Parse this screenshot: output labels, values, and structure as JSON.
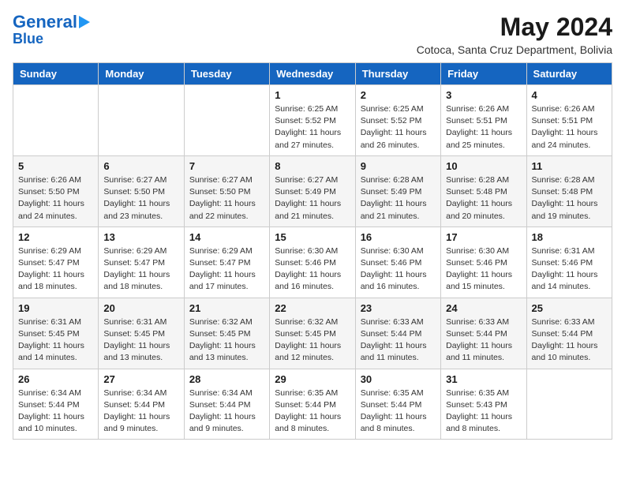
{
  "logo": {
    "line1": "General",
    "line2": "Blue"
  },
  "title": "May 2024",
  "subtitle": "Cotoca, Santa Cruz Department, Bolivia",
  "days_of_week": [
    "Sunday",
    "Monday",
    "Tuesday",
    "Wednesday",
    "Thursday",
    "Friday",
    "Saturday"
  ],
  "weeks": [
    [
      {
        "day": "",
        "info": ""
      },
      {
        "day": "",
        "info": ""
      },
      {
        "day": "",
        "info": ""
      },
      {
        "day": "1",
        "info": "Sunrise: 6:25 AM\nSunset: 5:52 PM\nDaylight: 11 hours and 27 minutes."
      },
      {
        "day": "2",
        "info": "Sunrise: 6:25 AM\nSunset: 5:52 PM\nDaylight: 11 hours and 26 minutes."
      },
      {
        "day": "3",
        "info": "Sunrise: 6:26 AM\nSunset: 5:51 PM\nDaylight: 11 hours and 25 minutes."
      },
      {
        "day": "4",
        "info": "Sunrise: 6:26 AM\nSunset: 5:51 PM\nDaylight: 11 hours and 24 minutes."
      }
    ],
    [
      {
        "day": "5",
        "info": "Sunrise: 6:26 AM\nSunset: 5:50 PM\nDaylight: 11 hours and 24 minutes."
      },
      {
        "day": "6",
        "info": "Sunrise: 6:27 AM\nSunset: 5:50 PM\nDaylight: 11 hours and 23 minutes."
      },
      {
        "day": "7",
        "info": "Sunrise: 6:27 AM\nSunset: 5:50 PM\nDaylight: 11 hours and 22 minutes."
      },
      {
        "day": "8",
        "info": "Sunrise: 6:27 AM\nSunset: 5:49 PM\nDaylight: 11 hours and 21 minutes."
      },
      {
        "day": "9",
        "info": "Sunrise: 6:28 AM\nSunset: 5:49 PM\nDaylight: 11 hours and 21 minutes."
      },
      {
        "day": "10",
        "info": "Sunrise: 6:28 AM\nSunset: 5:48 PM\nDaylight: 11 hours and 20 minutes."
      },
      {
        "day": "11",
        "info": "Sunrise: 6:28 AM\nSunset: 5:48 PM\nDaylight: 11 hours and 19 minutes."
      }
    ],
    [
      {
        "day": "12",
        "info": "Sunrise: 6:29 AM\nSunset: 5:47 PM\nDaylight: 11 hours and 18 minutes."
      },
      {
        "day": "13",
        "info": "Sunrise: 6:29 AM\nSunset: 5:47 PM\nDaylight: 11 hours and 18 minutes."
      },
      {
        "day": "14",
        "info": "Sunrise: 6:29 AM\nSunset: 5:47 PM\nDaylight: 11 hours and 17 minutes."
      },
      {
        "day": "15",
        "info": "Sunrise: 6:30 AM\nSunset: 5:46 PM\nDaylight: 11 hours and 16 minutes."
      },
      {
        "day": "16",
        "info": "Sunrise: 6:30 AM\nSunset: 5:46 PM\nDaylight: 11 hours and 16 minutes."
      },
      {
        "day": "17",
        "info": "Sunrise: 6:30 AM\nSunset: 5:46 PM\nDaylight: 11 hours and 15 minutes."
      },
      {
        "day": "18",
        "info": "Sunrise: 6:31 AM\nSunset: 5:46 PM\nDaylight: 11 hours and 14 minutes."
      }
    ],
    [
      {
        "day": "19",
        "info": "Sunrise: 6:31 AM\nSunset: 5:45 PM\nDaylight: 11 hours and 14 minutes."
      },
      {
        "day": "20",
        "info": "Sunrise: 6:31 AM\nSunset: 5:45 PM\nDaylight: 11 hours and 13 minutes."
      },
      {
        "day": "21",
        "info": "Sunrise: 6:32 AM\nSunset: 5:45 PM\nDaylight: 11 hours and 13 minutes."
      },
      {
        "day": "22",
        "info": "Sunrise: 6:32 AM\nSunset: 5:45 PM\nDaylight: 11 hours and 12 minutes."
      },
      {
        "day": "23",
        "info": "Sunrise: 6:33 AM\nSunset: 5:44 PM\nDaylight: 11 hours and 11 minutes."
      },
      {
        "day": "24",
        "info": "Sunrise: 6:33 AM\nSunset: 5:44 PM\nDaylight: 11 hours and 11 minutes."
      },
      {
        "day": "25",
        "info": "Sunrise: 6:33 AM\nSunset: 5:44 PM\nDaylight: 11 hours and 10 minutes."
      }
    ],
    [
      {
        "day": "26",
        "info": "Sunrise: 6:34 AM\nSunset: 5:44 PM\nDaylight: 11 hours and 10 minutes."
      },
      {
        "day": "27",
        "info": "Sunrise: 6:34 AM\nSunset: 5:44 PM\nDaylight: 11 hours and 9 minutes."
      },
      {
        "day": "28",
        "info": "Sunrise: 6:34 AM\nSunset: 5:44 PM\nDaylight: 11 hours and 9 minutes."
      },
      {
        "day": "29",
        "info": "Sunrise: 6:35 AM\nSunset: 5:44 PM\nDaylight: 11 hours and 8 minutes."
      },
      {
        "day": "30",
        "info": "Sunrise: 6:35 AM\nSunset: 5:44 PM\nDaylight: 11 hours and 8 minutes."
      },
      {
        "day": "31",
        "info": "Sunrise: 6:35 AM\nSunset: 5:43 PM\nDaylight: 11 hours and 8 minutes."
      },
      {
        "day": "",
        "info": ""
      }
    ]
  ]
}
